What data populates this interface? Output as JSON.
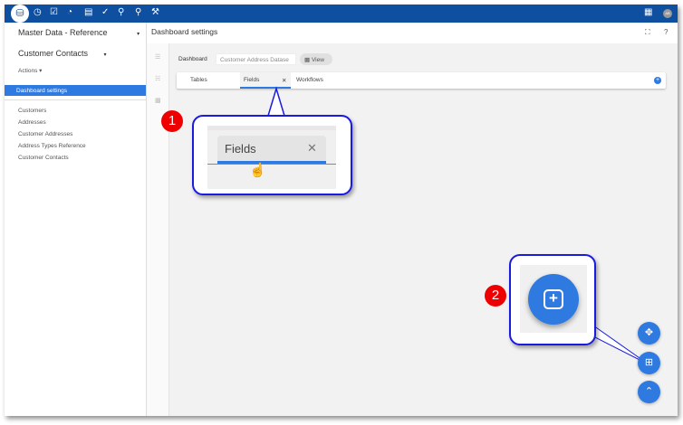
{
  "topbar": {
    "icons": [
      "database-icon",
      "clock-icon",
      "checklist-icon",
      "gauge-icon",
      "document-list-icon",
      "task-check-icon",
      "pin-icon",
      "search-icon",
      "wrench-icon"
    ],
    "right_icons": [
      "table-icon",
      "avatar"
    ],
    "avatar_text": "AB"
  },
  "sidebar": {
    "module": "Master Data - Reference",
    "entity": "Customer Contacts",
    "actions": "Actions",
    "active_item": "Dashboard settings",
    "items": [
      "Customers",
      "Addresses",
      "Customer Addresses",
      "Address Types Reference",
      "Customer Contacts"
    ]
  },
  "main": {
    "title": "Dashboard settings",
    "dashboard_label": "Dashboard",
    "dashboard_value": "Customer Address Datase",
    "view_button": "View",
    "tabs": [
      "Tables",
      "Fields",
      "Workflows"
    ]
  },
  "callout1": {
    "badge": "1",
    "tab_label": "Fields"
  },
  "callout2": {
    "badge": "2"
  },
  "colors": {
    "topbar": "#0f4fa0",
    "accent": "#2f7ae0",
    "badge": "#e00000",
    "callout_border": "#1a1ae0"
  }
}
